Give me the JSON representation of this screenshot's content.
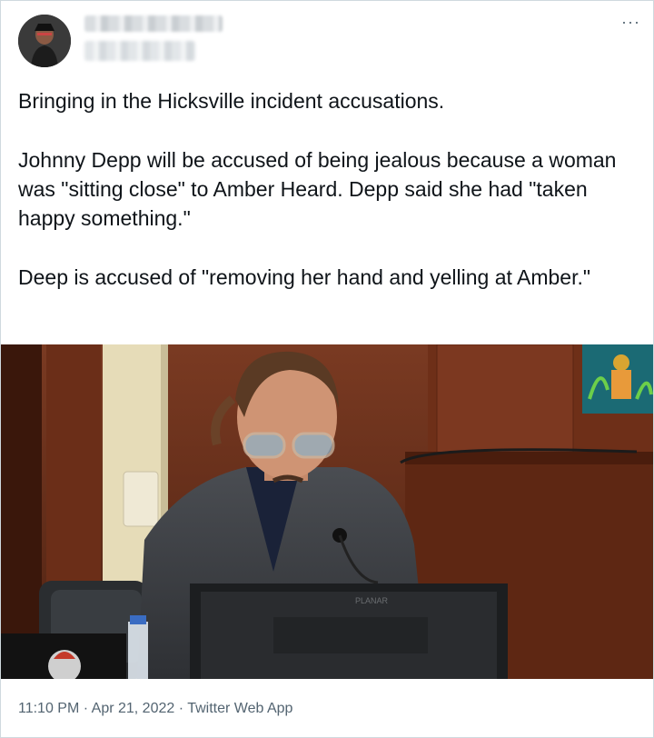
{
  "tweet": {
    "paragraphs": [
      "Bringing in the Hicksville incident accusations.",
      "Johnny Depp will be accused of being jealous because a woman was \"sitting close\" to Amber Heard. Depp said she had \"taken happy something.\"",
      "Deep is accused of \"removing her hand and yelling at Amber.\""
    ],
    "more_icon": "more-dots-icon",
    "meta": {
      "time": "11:10 PM",
      "separator": " · ",
      "date": "Apr 21, 2022",
      "source": "Twitter Web App"
    },
    "media_overlay_text": "PLANAR"
  },
  "colors": {
    "text": "#0f1419",
    "secondary": "#536471",
    "border": "#cfd9de"
  }
}
